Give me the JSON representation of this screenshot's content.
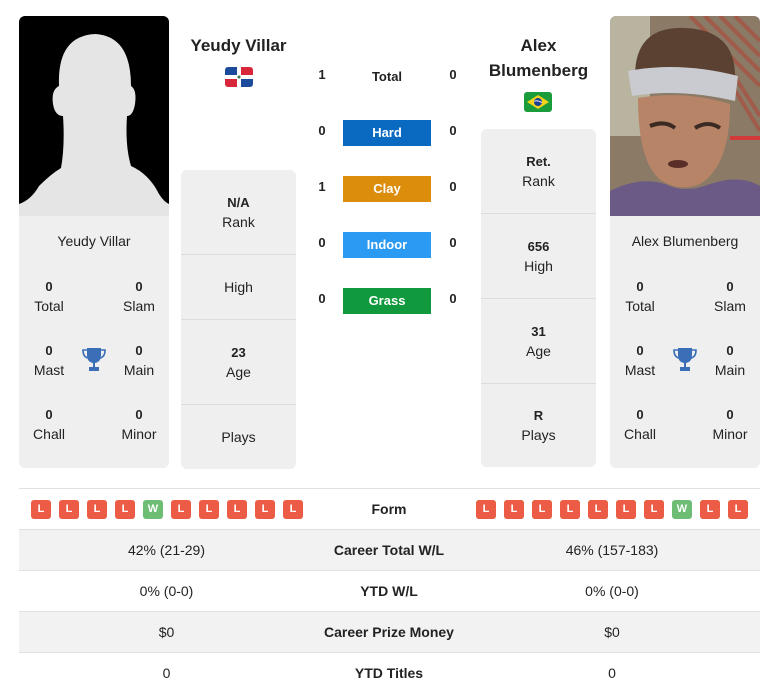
{
  "player1": {
    "name": "Yeudy Villar",
    "name_card": "Yeudy Villar",
    "country": "Dominican Republic",
    "flag_icon": "flag-dominican-republic-icon",
    "photo": "silhouette-placeholder",
    "titles": {
      "total": {
        "value": "0",
        "label": "Total"
      },
      "slam": {
        "value": "0",
        "label": "Slam"
      },
      "mast": {
        "value": "0",
        "label": "Mast"
      },
      "main": {
        "value": "0",
        "label": "Main"
      },
      "chall": {
        "value": "0",
        "label": "Chall"
      },
      "minor": {
        "value": "0",
        "label": "Minor"
      }
    },
    "info": {
      "rank": {
        "value": "N/A",
        "label": "Rank"
      },
      "high": {
        "value": "",
        "label": "High"
      },
      "age": {
        "value": "23",
        "label": "Age"
      },
      "plays": {
        "value": "",
        "label": "Plays"
      }
    },
    "form": [
      "L",
      "L",
      "L",
      "L",
      "W",
      "L",
      "L",
      "L",
      "L",
      "L"
    ]
  },
  "player2": {
    "name": "Alex Blumenberg",
    "name_line1": "Alex",
    "name_line2": "Blumenberg",
    "name_card": "Alex Blumenberg",
    "country": "Brazil",
    "flag_icon": "flag-brazil-icon",
    "photo": "player-photo",
    "titles": {
      "total": {
        "value": "0",
        "label": "Total"
      },
      "slam": {
        "value": "0",
        "label": "Slam"
      },
      "mast": {
        "value": "0",
        "label": "Mast"
      },
      "main": {
        "value": "0",
        "label": "Main"
      },
      "chall": {
        "value": "0",
        "label": "Chall"
      },
      "minor": {
        "value": "0",
        "label": "Minor"
      }
    },
    "info": {
      "rank": {
        "value": "Ret.",
        "label": "Rank"
      },
      "high": {
        "value": "656",
        "label": "High"
      },
      "age": {
        "value": "31",
        "label": "Age"
      },
      "plays": {
        "value": "R",
        "label": "Plays"
      }
    },
    "form": [
      "L",
      "L",
      "L",
      "L",
      "L",
      "L",
      "L",
      "W",
      "L",
      "L"
    ]
  },
  "h2h": {
    "total": {
      "label": "Total",
      "p1": "1",
      "p2": "0"
    },
    "surfaces": [
      {
        "label": "Hard",
        "p1": "0",
        "p2": "0",
        "color": "#0a6ac2"
      },
      {
        "label": "Clay",
        "p1": "1",
        "p2": "0",
        "color": "#dc8d0c"
      },
      {
        "label": "Indoor",
        "p1": "0",
        "p2": "0",
        "color": "#2b9af2"
      },
      {
        "label": "Grass",
        "p1": "0",
        "p2": "0",
        "color": "#109a3d"
      }
    ]
  },
  "table": {
    "form_label": "Form",
    "rows": [
      {
        "label": "Career Total W/L",
        "p1": "42% (21-29)",
        "p2": "46% (157-183)"
      },
      {
        "label": "YTD W/L",
        "p1": "0% (0-0)",
        "p2": "0% (0-0)"
      },
      {
        "label": "Career Prize Money",
        "p1": "$0",
        "p2": "$0"
      },
      {
        "label": "YTD Titles",
        "p1": "0",
        "p2": "0"
      }
    ]
  },
  "colors": {
    "loss": "#ec5b45",
    "win": "#6dbd74",
    "trophy": "#3a6fb8",
    "card_bg": "#efefef"
  }
}
